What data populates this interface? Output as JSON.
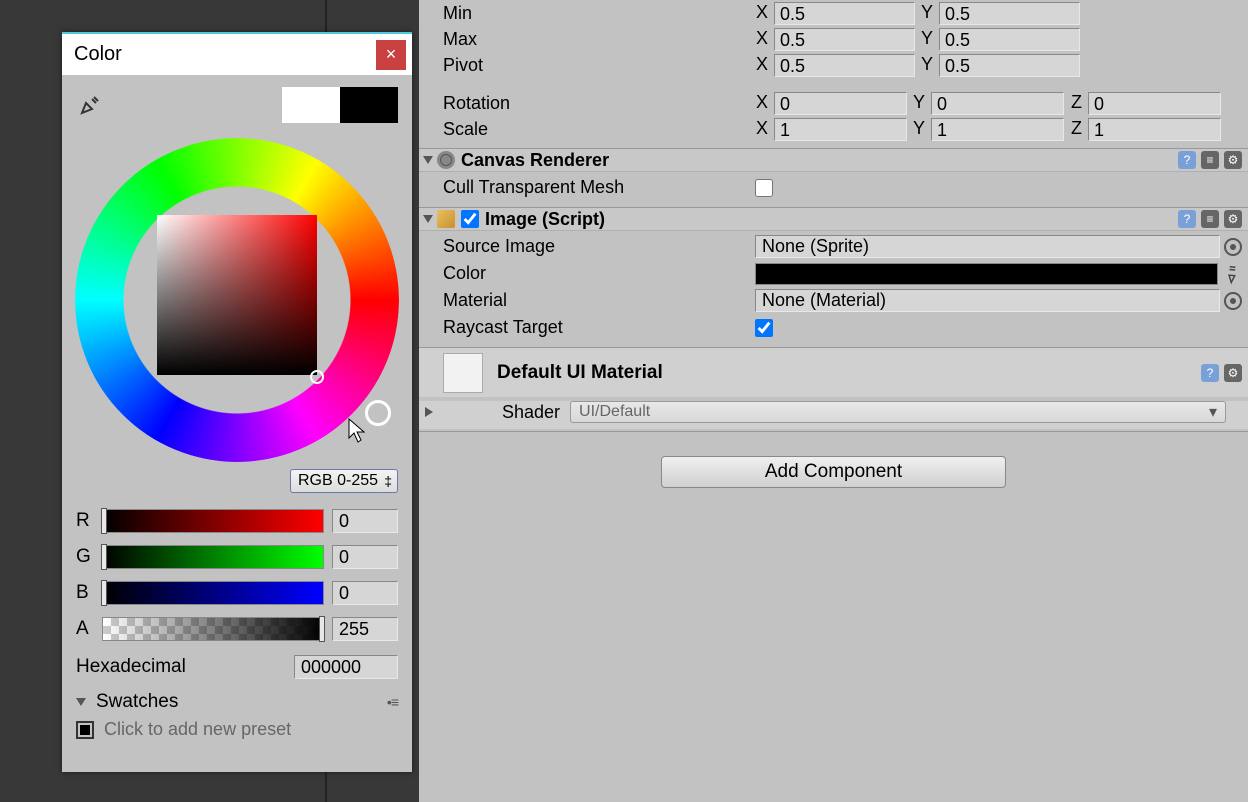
{
  "inspector": {
    "transform": {
      "min": {
        "label": "Min",
        "x": "0.5",
        "y": "0.5"
      },
      "max": {
        "label": "Max",
        "x": "0.5",
        "y": "0.5"
      },
      "pivot": {
        "label": "Pivot",
        "x": "0.5",
        "y": "0.5"
      },
      "rotation": {
        "label": "Rotation",
        "x": "0",
        "y": "0",
        "z": "0"
      },
      "scale": {
        "label": "Scale",
        "x": "1",
        "y": "1",
        "z": "1"
      }
    },
    "canvas_renderer": {
      "title": "Canvas Renderer",
      "cull_label": "Cull Transparent Mesh",
      "cull_value": false
    },
    "image": {
      "title": "Image (Script)",
      "enabled": true,
      "source_image": {
        "label": "Source Image",
        "value": "None (Sprite)"
      },
      "color": {
        "label": "Color",
        "value": "#000000"
      },
      "material": {
        "label": "Material",
        "value": "None (Material)"
      },
      "raycast": {
        "label": "Raycast Target",
        "value": true
      }
    },
    "default_material": {
      "title": "Default UI Material",
      "shader_label": "Shader",
      "shader_value": "UI/Default"
    },
    "add_component": "Add Component"
  },
  "color_picker": {
    "title": "Color",
    "mode": "RGB 0-255",
    "channels": {
      "r": {
        "label": "R",
        "value": "0"
      },
      "g": {
        "label": "G",
        "value": "0"
      },
      "b": {
        "label": "B",
        "value": "0"
      },
      "a": {
        "label": "A",
        "value": "255"
      }
    },
    "hex": {
      "label": "Hexadecimal",
      "value": "000000"
    },
    "swatches": {
      "label": "Swatches",
      "hint": "Click to add new preset"
    },
    "preview": {
      "previous": "#FFFFFF",
      "current": "#000000"
    }
  },
  "labels": {
    "x": "X",
    "y": "Y",
    "z": "Z"
  }
}
